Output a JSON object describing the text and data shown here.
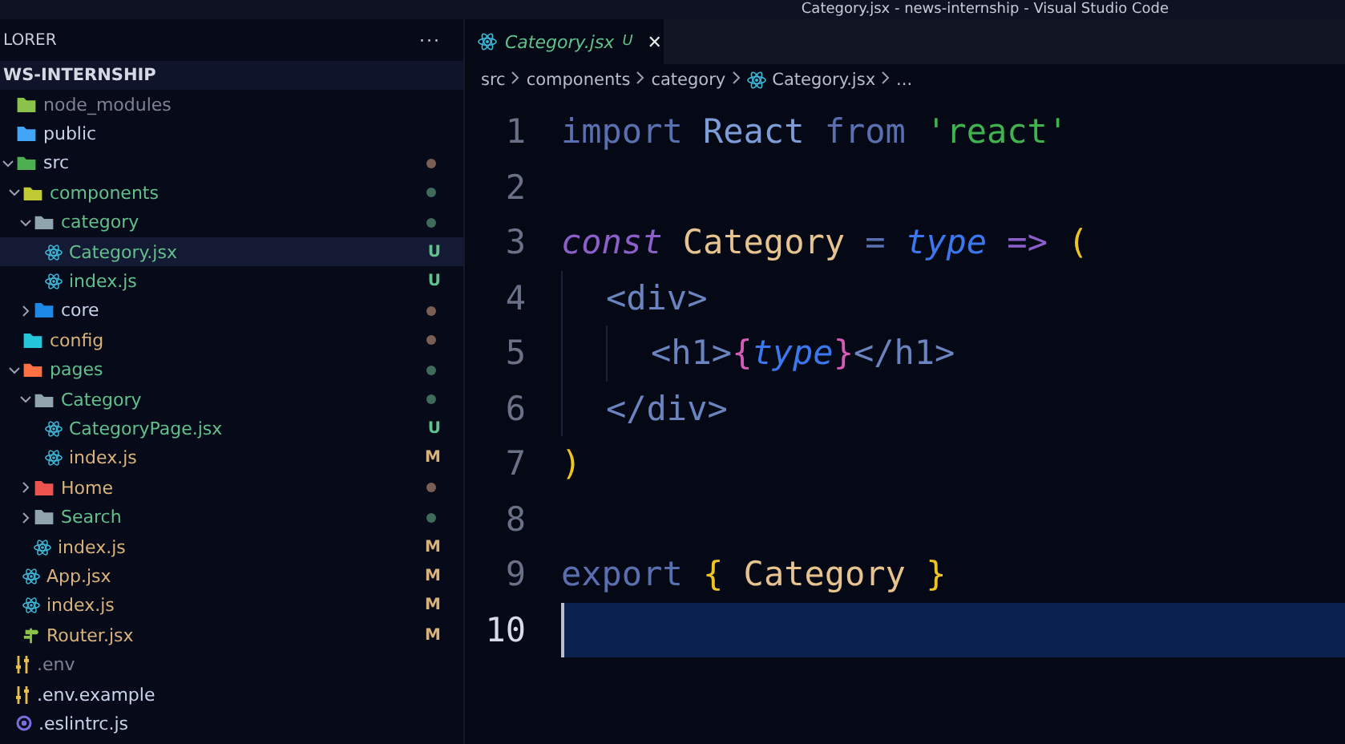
{
  "window": {
    "title": "Category.jsx - news-internship - Visual Studio Code"
  },
  "sidebar": {
    "title": "LORER",
    "more": "···",
    "section": "WS-INTERNSHIP",
    "items": [
      {
        "name": "node_modules",
        "kind": "nodefolder",
        "ignored": true
      },
      {
        "name": "public",
        "kind": "publicfolder"
      },
      {
        "name": "src",
        "kind": "srcfolder",
        "expanded": true,
        "dot": true,
        "children": [
          {
            "name": "components",
            "kind": "componentsfolder",
            "untracked": true,
            "expanded": true,
            "dot": true,
            "children": [
              {
                "name": "category",
                "kind": "folder",
                "untracked": true,
                "expanded": true,
                "dot": true,
                "children": [
                  {
                    "name": "Category.jsx",
                    "kind": "react",
                    "untracked": true,
                    "badge": "U",
                    "selected": true
                  },
                  {
                    "name": "index.js",
                    "kind": "react",
                    "untracked": true,
                    "badge": "U",
                    "selected": false
                  }
                ]
              },
              {
                "name": "core",
                "kind": "corefolder",
                "expanded": false,
                "dot": true
              }
            ]
          },
          {
            "name": "config",
            "kind": "configfolder",
            "modified": true,
            "dot": true
          },
          {
            "name": "pages",
            "kind": "pagesfolder",
            "untracked": true,
            "expanded": true,
            "dot": true,
            "children": [
              {
                "name": "Category",
                "kind": "folder",
                "untracked": true,
                "expanded": true,
                "dot": true,
                "children": [
                  {
                    "name": "CategoryPage.jsx",
                    "kind": "react",
                    "untracked": true,
                    "badge": "U",
                    "selected": false
                  },
                  {
                    "name": "index.js",
                    "kind": "react",
                    "modified": true,
                    "badge": "M",
                    "selected": false
                  }
                ]
              },
              {
                "name": "Home",
                "kind": "homefolder",
                "modified": true,
                "expanded": false,
                "dot": true
              },
              {
                "name": "Search",
                "kind": "folder",
                "untracked": true,
                "expanded": false,
                "dot": true
              },
              {
                "name": "index.js",
                "kind": "react",
                "modified": true,
                "badge": "M",
                "selected": false
              }
            ]
          },
          {
            "name": "App.jsx",
            "kind": "react",
            "modified": true,
            "badge": "M",
            "selected": false
          },
          {
            "name": "index.js",
            "kind": "react",
            "modified": true,
            "badge": "M",
            "selected": false
          },
          {
            "name": "Router.jsx",
            "kind": "router",
            "modified": true,
            "badge": "M",
            "selected": false
          }
        ]
      },
      {
        "name": ".env",
        "kind": "env",
        "ignored": true
      },
      {
        "name": ".env.example",
        "kind": "env"
      },
      {
        "name": ".eslintrc.js",
        "kind": "eslint"
      }
    ]
  },
  "tabs": [
    {
      "label": "Category.jsx",
      "badge": "U",
      "close": "✕",
      "selected": true
    }
  ],
  "breadcrumbs": [
    {
      "label": "src",
      "kind": "text"
    },
    {
      "label": "components",
      "kind": "text"
    },
    {
      "label": "category",
      "kind": "text"
    },
    {
      "label": "Category.jsx",
      "kind": "react"
    },
    {
      "label": "...",
      "kind": "text"
    }
  ],
  "code": [
    {
      "number": "1",
      "current": false,
      "tokens": [
        {
          "t": "import",
          "kind": "kw"
        },
        {
          "t": " React",
          "kind": "name"
        },
        {
          "t": " from",
          "kind": "kw"
        },
        {
          "t": " 'react'",
          "kind": "str"
        }
      ]
    },
    {
      "number": "2",
      "current": false
    },
    {
      "number": "3",
      "current": false,
      "tokens": [
        {
          "t": "const",
          "kind": "decl"
        },
        {
          "t": " Category",
          "kind": "cls"
        },
        {
          "t": " =",
          "kind": "op"
        },
        {
          "t": " type",
          "kind": "param"
        },
        {
          "t": " =>",
          "kind": "arrow"
        },
        {
          "t": " (",
          "kind": "brk"
        }
      ],
      "children": [
        {
          "number": "4",
          "current": false,
          "tokens": [
            {
              "t": "<div>",
              "kind": "tag"
            }
          ],
          "children": [
            {
              "number": "5",
              "current": false,
              "tokens": [
                {
                  "t": "<h1>",
                  "kind": "tag"
                },
                {
                  "t": "{",
                  "kind": "brk2"
                },
                {
                  "t": "type",
                  "kind": "param"
                },
                {
                  "t": "}",
                  "kind": "brk2"
                },
                {
                  "t": "</h1>",
                  "kind": "tag"
                }
              ]
            }
          ]
        },
        {
          "number": "6",
          "current": false,
          "tokens": [
            {
              "t": "</div>",
              "kind": "tag"
            }
          ]
        }
      ]
    },
    {
      "number": "7",
      "current": false,
      "tokens": [
        {
          "t": ")",
          "kind": "brk"
        }
      ]
    },
    {
      "number": "8",
      "current": false
    },
    {
      "number": "9",
      "current": false,
      "tokens": [
        {
          "t": "export",
          "kind": "kw"
        },
        {
          "t": " {",
          "kind": "brk"
        },
        {
          "t": " Category",
          "kind": "cls"
        },
        {
          "t": " }",
          "kind": "brk"
        }
      ]
    },
    {
      "number": "10",
      "current": true
    }
  ]
}
